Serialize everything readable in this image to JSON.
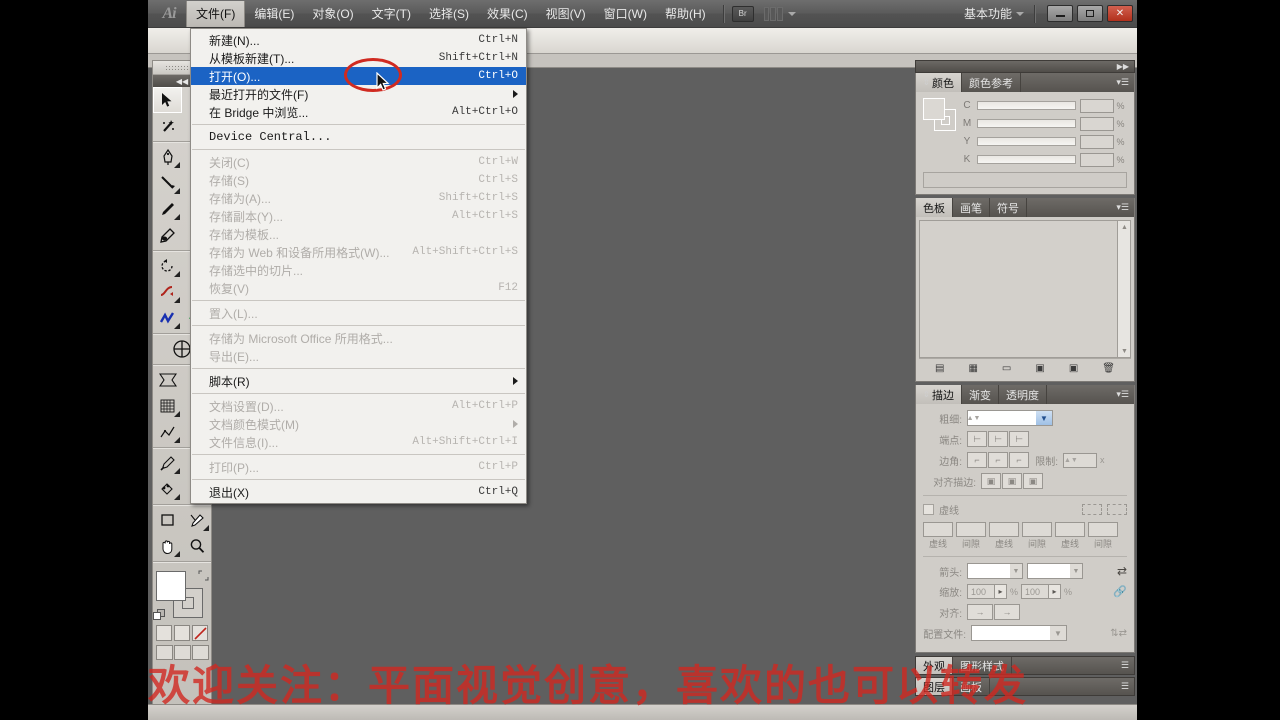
{
  "app": {
    "logo": "Ai",
    "workspace_label": "基本功能",
    "bridge_button": "Br"
  },
  "menubar": {
    "items": [
      {
        "label": "文件(F)",
        "active": true
      },
      {
        "label": "编辑(E)",
        "active": false
      },
      {
        "label": "对象(O)",
        "active": false
      },
      {
        "label": "文字(T)",
        "active": false
      },
      {
        "label": "选择(S)",
        "active": false
      },
      {
        "label": "效果(C)",
        "active": false
      },
      {
        "label": "视图(V)",
        "active": false
      },
      {
        "label": "窗口(W)",
        "active": false
      },
      {
        "label": "帮助(H)",
        "active": false
      }
    ]
  },
  "window_controls": {
    "minimize": "minimize",
    "restore": "restore",
    "close": "close"
  },
  "file_menu": {
    "rows": [
      {
        "label": "新建(N)...",
        "accel": "Ctrl+N",
        "state": "normal"
      },
      {
        "label": "从模板新建(T)...",
        "accel": "Shift+Ctrl+N",
        "state": "normal"
      },
      {
        "label": "打开(O)...",
        "accel": "Ctrl+O",
        "state": "highlight"
      },
      {
        "label": "最近打开的文件(F)",
        "accel": "",
        "state": "normal",
        "submenu": true
      },
      {
        "label": "在 Bridge 中浏览...",
        "accel": "Alt+Ctrl+O",
        "state": "normal"
      },
      {
        "sep": true
      },
      {
        "label": "Device Central...",
        "accel": "",
        "state": "normal",
        "mono": true
      },
      {
        "sep": true
      },
      {
        "label": "关闭(C)",
        "accel": "Ctrl+W",
        "state": "disabled"
      },
      {
        "label": "存储(S)",
        "accel": "Ctrl+S",
        "state": "disabled"
      },
      {
        "label": "存储为(A)...",
        "accel": "Shift+Ctrl+S",
        "state": "disabled"
      },
      {
        "label": "存储副本(Y)...",
        "accel": "Alt+Ctrl+S",
        "state": "disabled"
      },
      {
        "label": "存储为模板...",
        "accel": "",
        "state": "disabled"
      },
      {
        "label": "存储为 Web 和设备所用格式(W)...",
        "accel": "Alt+Shift+Ctrl+S",
        "state": "disabled"
      },
      {
        "label": "存储选中的切片...",
        "accel": "",
        "state": "disabled"
      },
      {
        "label": "恢复(V)",
        "accel": "F12",
        "state": "disabled"
      },
      {
        "sep": true
      },
      {
        "label": "置入(L)...",
        "accel": "",
        "state": "disabled"
      },
      {
        "sep": true
      },
      {
        "label": "存储为 Microsoft Office 所用格式...",
        "accel": "",
        "state": "disabled"
      },
      {
        "label": "导出(E)...",
        "accel": "",
        "state": "disabled"
      },
      {
        "sep": true
      },
      {
        "label": "脚本(R)",
        "accel": "",
        "state": "normal",
        "submenu": true
      },
      {
        "sep": true
      },
      {
        "label": "文档设置(D)...",
        "accel": "Alt+Ctrl+P",
        "state": "disabled"
      },
      {
        "label": "文档颜色模式(M)",
        "accel": "",
        "state": "disabled",
        "submenu": true
      },
      {
        "label": "文件信息(I)...",
        "accel": "Alt+Shift+Ctrl+I",
        "state": "disabled"
      },
      {
        "sep": true
      },
      {
        "label": "打印(P)...",
        "accel": "Ctrl+P",
        "state": "disabled"
      },
      {
        "sep": true
      },
      {
        "label": "退出(X)",
        "accel": "Ctrl+Q",
        "state": "normal"
      }
    ]
  },
  "annotation": {
    "circle_color": "#d02a20",
    "target": "打开(O)..."
  },
  "panels": {
    "color": {
      "tabs": [
        {
          "label": "颜色",
          "active": true
        },
        {
          "label": "颜色参考",
          "active": false
        }
      ],
      "channels": [
        {
          "label": "C",
          "value": "",
          "unit": "%"
        },
        {
          "label": "M",
          "value": "",
          "unit": "%"
        },
        {
          "label": "Y",
          "value": "",
          "unit": "%"
        },
        {
          "label": "K",
          "value": "",
          "unit": "%"
        }
      ]
    },
    "swatches": {
      "tabs": [
        {
          "label": "色板",
          "active": true
        },
        {
          "label": "画笔",
          "active": false
        },
        {
          "label": "符号",
          "active": false
        }
      ],
      "footer_icons": [
        "swatch-library-icon",
        "show-swatch-kinds-icon",
        "swatch-options-icon",
        "new-color-group-icon",
        "new-swatch-icon",
        "delete-swatch-icon"
      ]
    },
    "stroke": {
      "tabs": [
        {
          "label": "描边",
          "active": true
        },
        {
          "label": "渐变",
          "active": false
        },
        {
          "label": "透明度",
          "active": false
        }
      ],
      "weight_label": "粗细:",
      "weight_value": "",
      "cap_label": "端点:",
      "corner_label": "边角:",
      "limit_label": "限制:",
      "limit_value": "",
      "limit_unit": "x",
      "align_label": "对齐描边:",
      "dashed_label": "虚线",
      "dash_labels": [
        "虚线",
        "间隙",
        "虚线",
        "间隙",
        "虚线",
        "间隙"
      ],
      "arrow_label": "箭头:",
      "scale_label": "缩放:",
      "scale_values": [
        "100",
        "100"
      ],
      "scale_unit": "%",
      "align_dash_label": "对齐:",
      "profile_label": "配置文件:"
    },
    "bottom_tabs": [
      [
        {
          "label": "外观",
          "active": true
        },
        {
          "label": "图形样式",
          "active": false
        }
      ],
      [
        {
          "label": "图层",
          "active": true
        },
        {
          "label": "画板",
          "active": false
        }
      ]
    ]
  },
  "toolbox": {
    "tools": [
      "selection-tool",
      "direct-selection-tool",
      "magic-wand-tool",
      "lasso-tool",
      "pen-tool",
      "type-tool",
      "line-segment-tool",
      "rectangle-tool",
      "paintbrush-tool",
      "pencil-tool",
      "blob-brush-tool",
      "eraser-tool",
      "rotate-tool",
      "scale-tool",
      "width-tool",
      "free-transform-tool",
      "shape-builder-tool",
      "perspective-grid-tool",
      "mesh-tool",
      "gradient-tool",
      "eyedropper-tool",
      "blend-tool",
      "symbol-sprayer-tool",
      "column-graph-tool",
      "artboard-tool",
      "slice-tool",
      "hand-tool",
      "zoom-tool"
    ]
  },
  "watermark": {
    "text": "欢迎关注：平面视觉创意，喜欢的也可以转发",
    "color": "#d02820"
  }
}
